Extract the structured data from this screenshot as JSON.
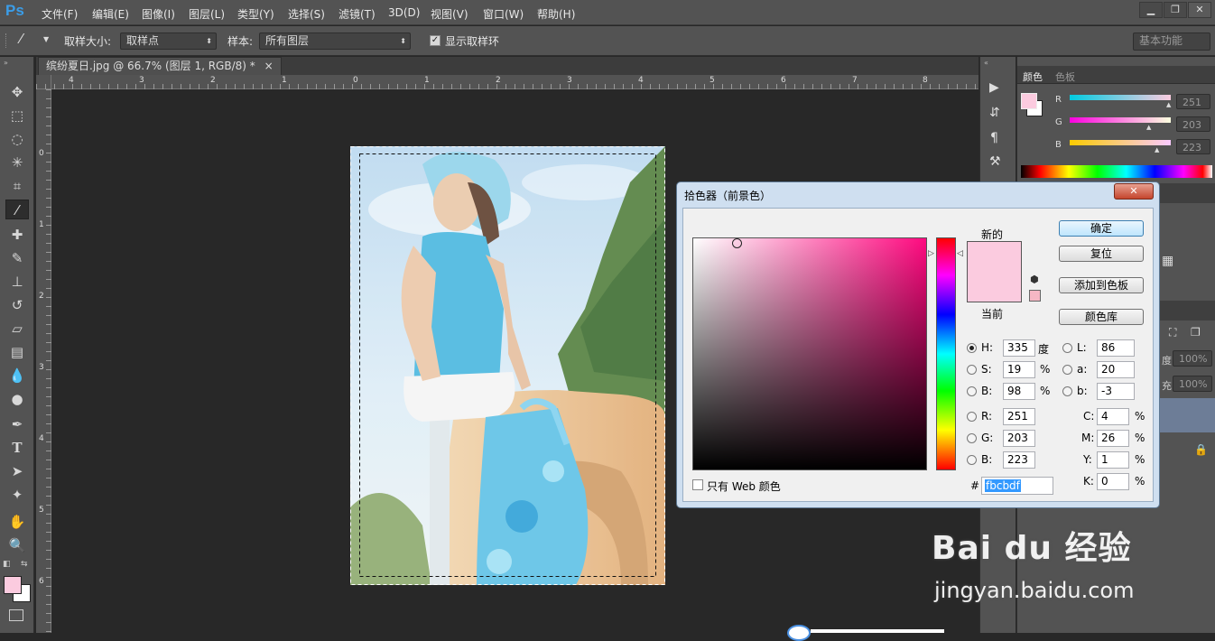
{
  "app": {
    "logo": "Ps"
  },
  "menu": [
    "文件(F)",
    "编辑(E)",
    "图像(I)",
    "图层(L)",
    "类型(Y)",
    "选择(S)",
    "滤镜(T)",
    "3D(D)",
    "视图(V)",
    "窗口(W)",
    "帮助(H)"
  ],
  "window_controls": {
    "minimize": "▁",
    "restore": "❐",
    "close": "✕"
  },
  "options": {
    "sample_size_label": "取样大小:",
    "sample_size_value": "取样点",
    "sample_label": "样本:",
    "sample_value": "所有图层",
    "show_ring_label": "显示取样环",
    "show_ring_checked": true,
    "workspace": "基本功能"
  },
  "document_tab": {
    "title": "缤纷夏日.jpg @ 66.7% (图层 1, RGB/8) *",
    "close": "×"
  },
  "ruler": {
    "h_labels": [
      "4",
      "3",
      "2",
      "1",
      "0",
      "1",
      "2",
      "3",
      "4",
      "5",
      "6",
      "7",
      "8"
    ],
    "v_labels": [
      "0",
      "1",
      "2",
      "3",
      "4",
      "5",
      "6"
    ]
  },
  "tools": [
    "move-icon",
    "marquee-icon",
    "lasso-icon",
    "magic-wand-icon",
    "crop-icon",
    "eyedropper-icon",
    "healing-icon",
    "brush-icon",
    "stamp-icon",
    "history-brush-icon",
    "eraser-icon",
    "gradient-icon",
    "blur-icon",
    "dodge-icon",
    "pen-icon",
    "type-icon",
    "path-select-icon",
    "shape-icon",
    "hand-icon",
    "zoom-icon"
  ],
  "color_panel": {
    "tabs": [
      "颜色",
      "色板"
    ],
    "r_label": "R",
    "r_value": "251",
    "g_label": "G",
    "g_value": "203",
    "b_label": "B",
    "b_value": "223",
    "fg_color": "#fbcbdf"
  },
  "layers_panel": {
    "opacity_label": "度:",
    "opacity_value": "100%",
    "fill_label": "充:",
    "fill_value": "100%"
  },
  "color_picker": {
    "title": "拾色器（前景色）",
    "close": "✕",
    "new_label": "新的",
    "current_label": "当前",
    "new_color": "#fbcbdf",
    "current_color": "#fbcbdf",
    "hue_color": "#ff0a80",
    "buttons": {
      "ok": "确定",
      "reset": "复位",
      "add_swatch": "添加到色板",
      "library": "颜色库"
    },
    "fields": {
      "H": {
        "label": "H:",
        "value": "335",
        "unit": "度"
      },
      "S": {
        "label": "S:",
        "value": "19",
        "unit": "%"
      },
      "Bv": {
        "label": "B:",
        "value": "98",
        "unit": "%"
      },
      "R": {
        "label": "R:",
        "value": "251"
      },
      "G": {
        "label": "G:",
        "value": "203"
      },
      "B": {
        "label": "B:",
        "value": "223"
      },
      "L": {
        "label": "L:",
        "value": "86"
      },
      "a": {
        "label": "a:",
        "value": "20"
      },
      "b": {
        "label": "b:",
        "value": "-3"
      },
      "C": {
        "label": "C:",
        "value": "4",
        "unit": "%"
      },
      "M": {
        "label": "M:",
        "value": "26",
        "unit": "%"
      },
      "Y": {
        "label": "Y:",
        "value": "1",
        "unit": "%"
      },
      "K": {
        "label": "K:",
        "value": "0",
        "unit": "%"
      }
    },
    "hex_label": "#",
    "hex_value": "fbcbdf",
    "web_only_label": "只有 Web 颜色"
  },
  "watermark": {
    "brand": "Bai du 经验",
    "url": "jingyan.baidu.com"
  }
}
